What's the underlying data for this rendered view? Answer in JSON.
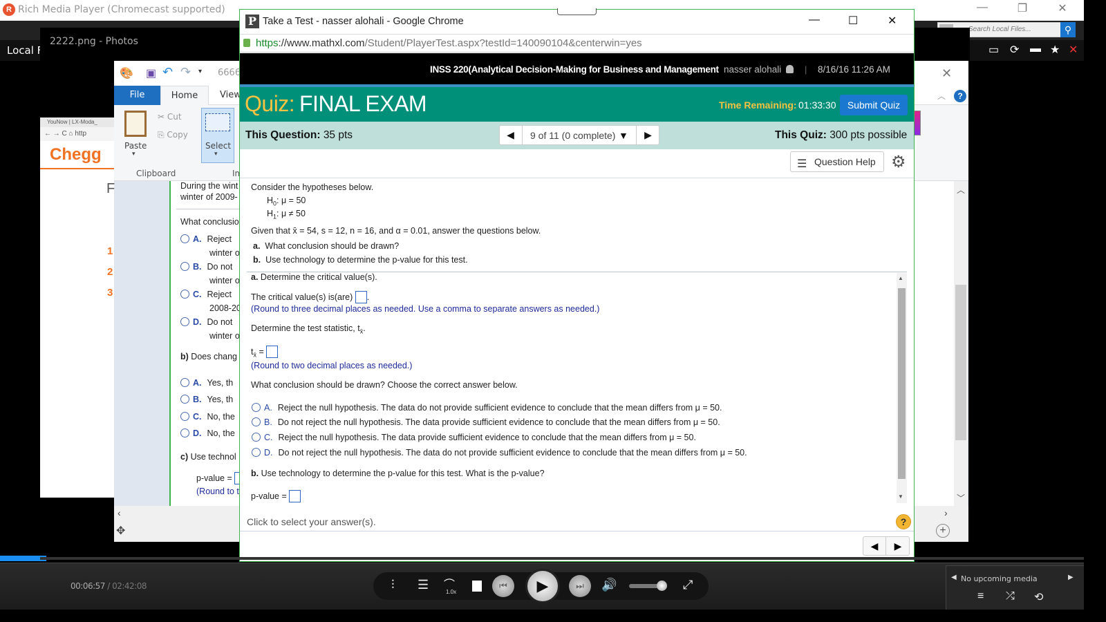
{
  "player": {
    "title": "Rich Media Player (Chromecast supported)",
    "logo": "R",
    "search_placeholder": "Search Local Files...",
    "local_label": "Local F",
    "time_current": "00:06:57",
    "time_total": " / 02:42:08",
    "speed": "1.0x",
    "volume_level": 0.85,
    "progress_fraction": 0.043,
    "up_next": "No upcoming media",
    "icons": [
      "equalizer-icon",
      "playlist-icon",
      "speed-icon",
      "stop-icon",
      "previous-icon",
      "play-icon",
      "next-icon",
      "volume-icon",
      "fullscreen-icon",
      "cast-icon",
      "refresh-icon",
      "folder-icon",
      "star-icon",
      "queue-icon",
      "shuffle-icon",
      "repeat-icon"
    ]
  },
  "photos": {
    "title": "2222.png - Photos"
  },
  "chegg": {
    "tab": "YouNow | LX-Moda_",
    "url_stub": "http",
    "logo": "Chegg",
    "side_numbers": [
      "1",
      "2",
      "3"
    ]
  },
  "paint": {
    "doc_title_stub": "6666",
    "tabs": [
      "File",
      "Home",
      "View"
    ],
    "clipboard": {
      "paste": "Paste",
      "cut": "Cut",
      "copy": "Copy",
      "group": "Clipboard"
    },
    "image_group": {
      "select": "Select",
      "group_stub": "Im"
    },
    "bg_question": {
      "intro_1": "During the wint",
      "intro_2": "winter of 2009-",
      "part_a": "What conclusio",
      "options_a": [
        {
          "letter": "A.",
          "line1": "Reject",
          "line2": "winter o"
        },
        {
          "letter": "B.",
          "line1": "Do not",
          "line2": "winter o"
        },
        {
          "letter": "C.",
          "line1": "Reject",
          "line2": "2008-20"
        },
        {
          "letter": "D.",
          "line1": "Do not",
          "line2": "winter o"
        }
      ],
      "part_b_label": "b)",
      "part_b": " Does chang",
      "options_b": [
        {
          "letter": "A.",
          "text": "Yes, th"
        },
        {
          "letter": "B.",
          "text": "Yes, th"
        },
        {
          "letter": "C.",
          "text": "No, the"
        },
        {
          "letter": "D.",
          "text": "No, the"
        }
      ],
      "part_c_label": "c)",
      "part_c": " Use technol",
      "pvalue_label": "p-value =",
      "round_note": "(Round to t"
    }
  },
  "chrome": {
    "title": "Take a Test - nasser alohali - Google Chrome",
    "favicon": "P",
    "url_scheme": "https",
    "url_host": "://www.mathxl.com",
    "url_path": "/Student/PlayerTest.aspx?testId=140090104&centerwin=yes"
  },
  "mathxl": {
    "course": "INSS 220(Analytical Decision-Making for Business and Management",
    "user": "nasser alohali",
    "separator": "|",
    "datetime": "8/16/16 11:26 AM",
    "quiz_label": "Quiz:",
    "quiz_name": "FINAL EXAM",
    "time_remaining_label": "Time Remaining:",
    "time_remaining": "01:33:30",
    "submit_label": "Submit Quiz",
    "this_question_label": "This Question:",
    "this_question_pts": "35 pts",
    "question_nav": "9 of 11 (0 complete)",
    "this_quiz_label": "This Quiz:",
    "this_quiz_pts": "300 pts possible",
    "question_help": "Question Help",
    "colors": {
      "header_teal": "#00907a",
      "info_bar": "#bfe0da",
      "accent_gold": "#f7c242",
      "submit_blue": "#1b78d0"
    }
  },
  "question": {
    "intro": "Consider the hypotheses below.",
    "h0": ": μ = 50",
    "h1": ": μ ≠ 50",
    "given": "Given that x̄ = 54, s = 12, n = 16, and α = 0.01, answer the questions below.",
    "parts": [
      {
        "label": "a.",
        "text": "What conclusion should be drawn?"
      },
      {
        "label": "b.",
        "text": "Use technology to determine the p-value for this test."
      }
    ]
  },
  "answer": {
    "a_label": "a.",
    "a_heading": " Determine the critical value(s).",
    "critical_prompt": "The critical value(s) is(are)",
    "critical_value": "",
    "critical_note": "(Round to three decimal places as needed. Use a comma to separate answers as needed.)",
    "stat_prompt": "Determine the test statistic, t",
    "stat_value": "",
    "stat_note": "(Round to two decimal places as needed.)",
    "conclusion_prompt": "What conclusion should be drawn? Choose the correct answer below.",
    "options": [
      {
        "letter": "A.",
        "text": "Reject the null hypothesis. The data do not provide sufficient evidence to conclude that the mean differs from μ = 50."
      },
      {
        "letter": "B.",
        "text": "Do not reject the null hypothesis. The data provide sufficient evidence to conclude that the mean differs from μ = 50."
      },
      {
        "letter": "C.",
        "text": "Reject the null hypothesis. The data provide sufficient evidence to conclude that the mean differs from μ = 50."
      },
      {
        "letter": "D.",
        "text": "Do not reject the null hypothesis. The data do not provide sufficient evidence to conclude that the mean differs from μ = 50."
      }
    ],
    "b_label": "b.",
    "b_heading": " Use technology to determine the p-value for this test. What is the p-value?",
    "pvalue_label": "p-value =",
    "pvalue": ""
  },
  "footer": {
    "hint": "Click to select your answer(s)."
  }
}
